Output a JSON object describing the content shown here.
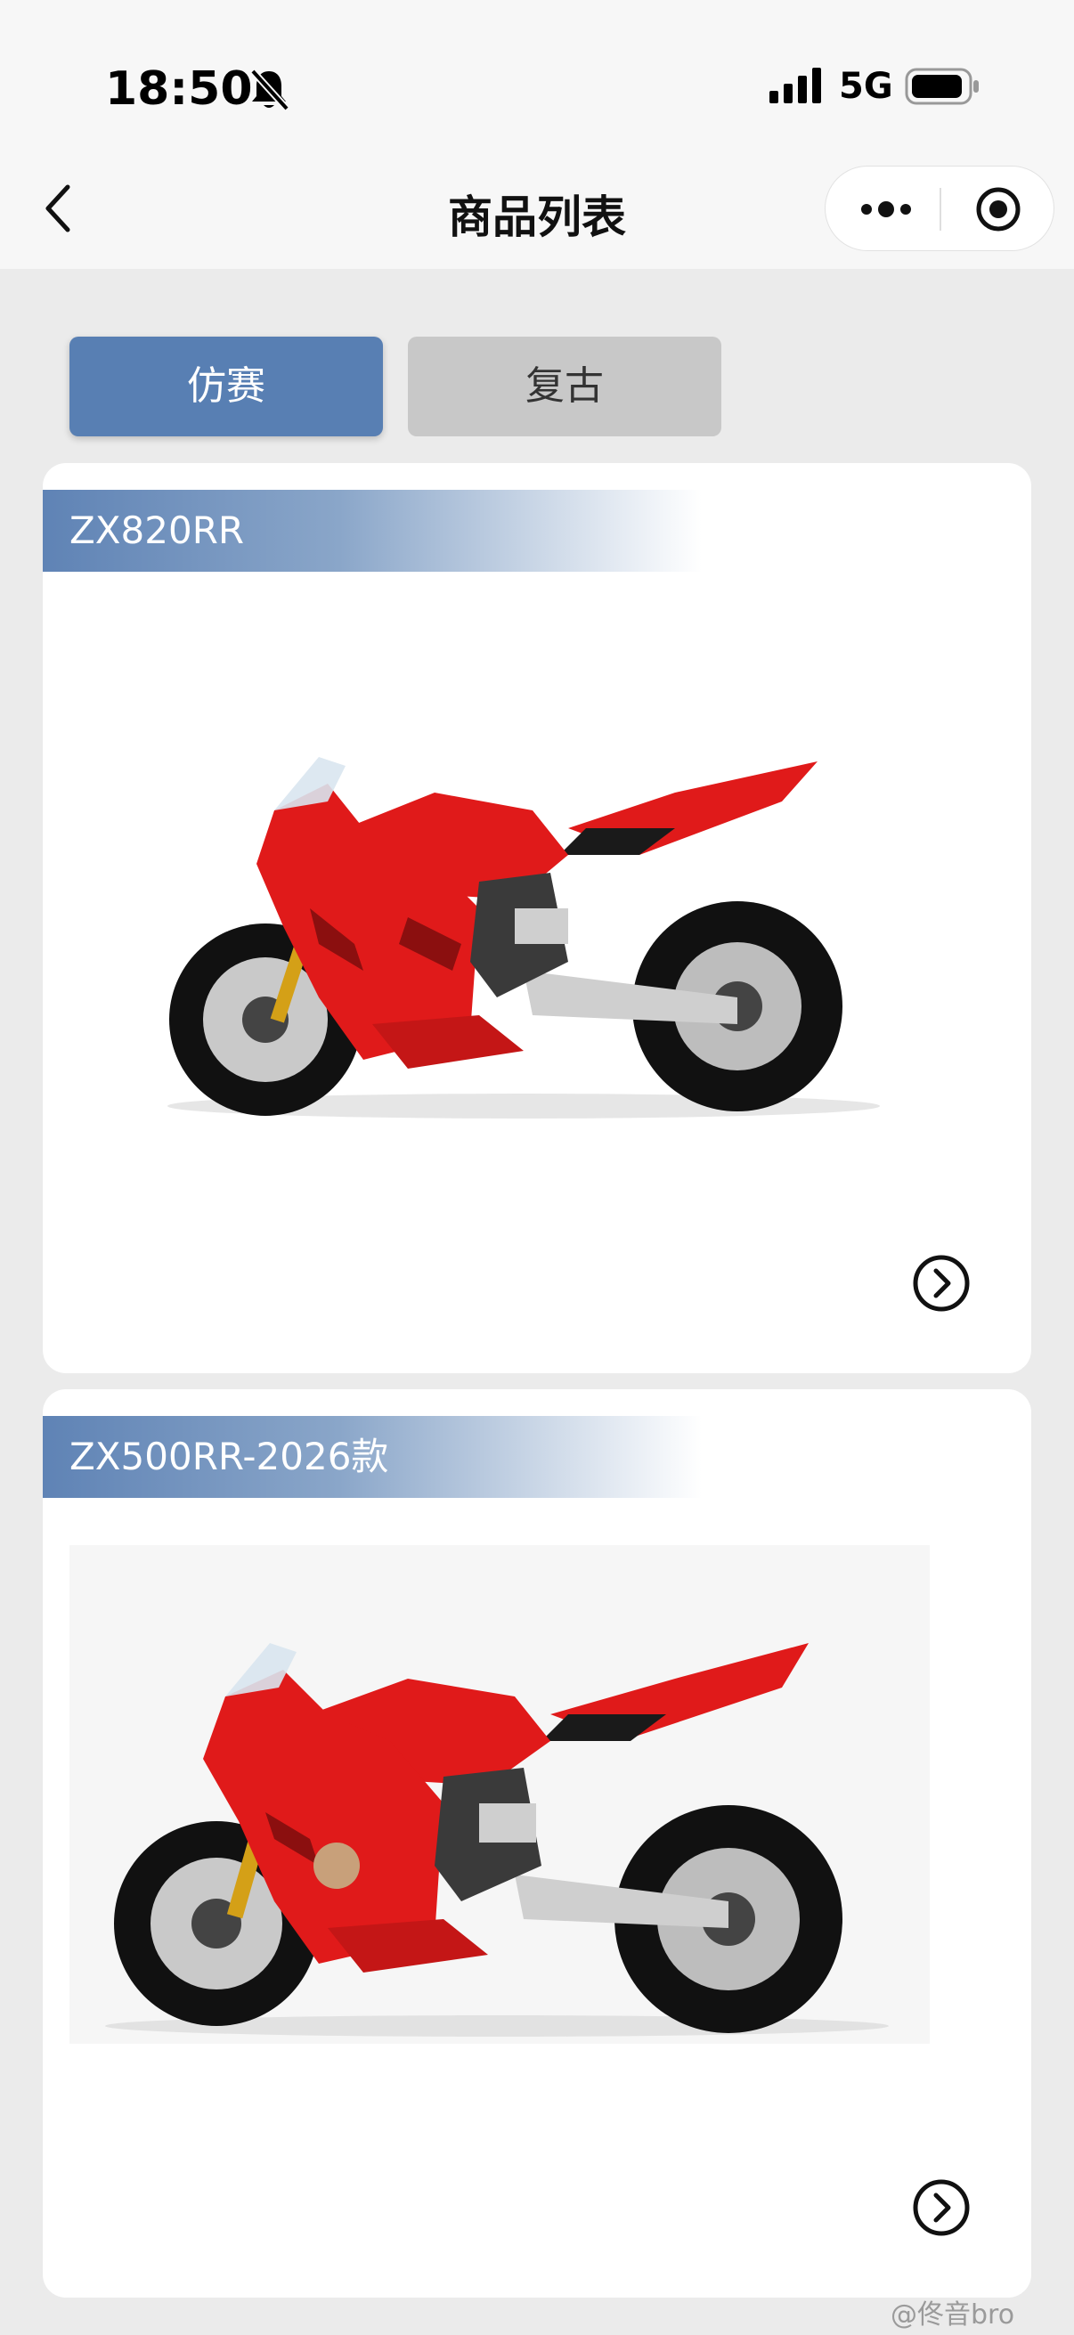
{
  "status": {
    "time": "18:50",
    "network": "5G"
  },
  "nav": {
    "title": "商品列表"
  },
  "tabs": [
    {
      "label": "仿赛",
      "active": true
    },
    {
      "label": "复古",
      "active": false
    }
  ],
  "products": [
    {
      "name": "ZX820RR"
    },
    {
      "name": "ZX500RR-2026款"
    }
  ],
  "colors": {
    "accent": "#587fb3",
    "tab_inactive": "#c8c8c8",
    "bike_red": "#e01a1a"
  },
  "watermark": "@佟音bro"
}
